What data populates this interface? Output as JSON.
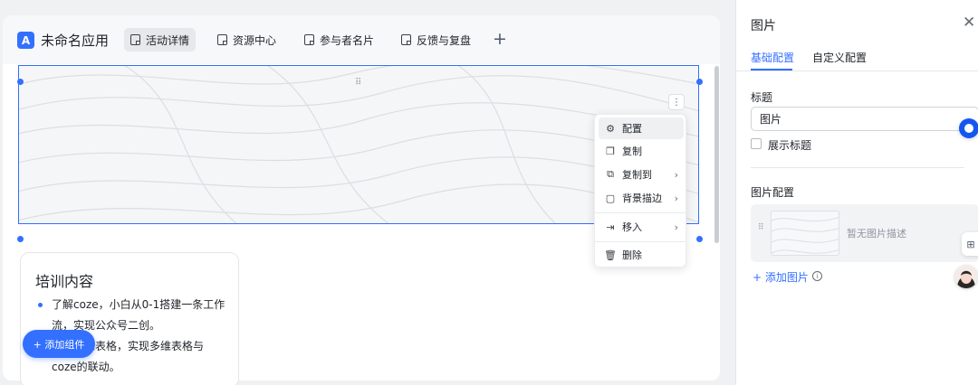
{
  "app": {
    "logo_glyph": "A",
    "name": "未命名应用",
    "tabs": [
      {
        "label": "活动详情",
        "active": true
      },
      {
        "label": "资源中心",
        "active": false
      },
      {
        "label": "参与者名片",
        "active": false
      },
      {
        "label": "反馈与复盘",
        "active": false
      }
    ],
    "add_tab_glyph": "+"
  },
  "canvas": {
    "drag_handle_glyph": "⠿",
    "more_glyph": "⋮",
    "context_menu": [
      {
        "label": "配置",
        "icon": "gear-icon",
        "glyph": "⚙",
        "submenu": false
      },
      {
        "label": "复制",
        "icon": "copy-icon",
        "glyph": "❐",
        "submenu": false
      },
      {
        "label": "复制到",
        "icon": "copy-to-icon",
        "glyph": "⧉",
        "submenu": true
      },
      {
        "label": "背景描边",
        "icon": "border-icon",
        "glyph": "▢",
        "submenu": true
      },
      {
        "label": "移入",
        "icon": "move-in-icon",
        "glyph": "⇥",
        "submenu": true
      },
      {
        "label": "删除",
        "icon": "trash-icon",
        "glyph": "🗑",
        "submenu": false
      }
    ],
    "submenu_glyph": "›",
    "training": {
      "title": "培训内容",
      "items": [
        "了解coze，小白从0-1搭建一条工作流，实现公众号二创。",
        "了解多维表格，实现多维表格与coze的联动。"
      ]
    },
    "add_component_label": "+ 添加组件"
  },
  "panel": {
    "title": "图片",
    "close_glyph": "✕",
    "tabs": [
      {
        "label": "基础配置",
        "active": true
      },
      {
        "label": "自定义配置",
        "active": false
      }
    ],
    "title_label": "标题",
    "title_value": "图片",
    "show_title_label": "展示标题",
    "image_config_label": "图片配置",
    "image_empty_desc": "暂无图片描述",
    "add_image_label": "+ 添加图片",
    "info_glyph": "i",
    "grid_glyph": "⊞"
  },
  "colors": {
    "accent": "#3370ff",
    "canvas_bg": "#f7f8fa"
  }
}
